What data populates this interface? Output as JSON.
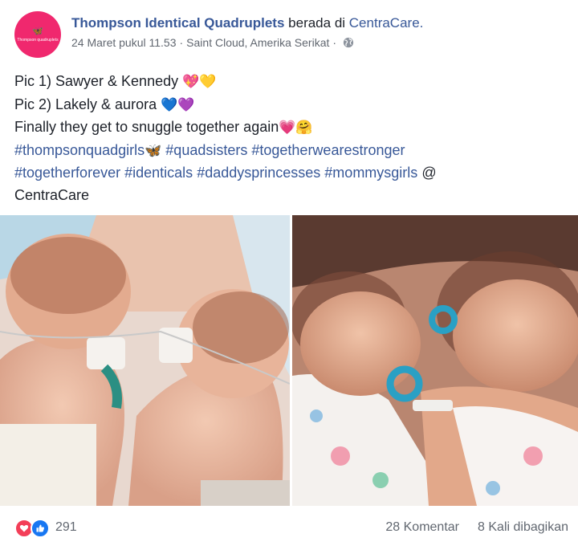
{
  "post": {
    "avatar_text": "Thompson quadruplets",
    "page_name": "Thompson Identical Quadruplets",
    "at_text": "berada di",
    "place": "CentraCare.",
    "timestamp": "24 Maret pukul 11.53",
    "separator": "·",
    "location": "Saint Cloud, Amerika Serikat",
    "privacy_icon": "globe-icon",
    "body": {
      "line1_text": "Pic 1) Sawyer & Kennedy",
      "line1_emoji": "💖💛",
      "line2_text": "Pic 2) Lakely & aurora",
      "line2_emoji": "💙💜",
      "line3_text": "Finally they get to snuggle together again",
      "line3_emoji": "💗🤗",
      "hashtags_line1": [
        "#thompsonquadgirls",
        "#quadsisters",
        "#togetherwearestronger"
      ],
      "hashtag_butterfly": "🦋",
      "hashtags_line2": [
        "#togetherforever",
        "#identicals",
        "#daddysprincesses",
        "#mommysgirls"
      ],
      "at_sign": "@",
      "mention": "CentraCare"
    }
  },
  "photos": [
    {
      "name": "photo-1"
    },
    {
      "name": "photo-2"
    }
  ],
  "footer": {
    "reaction_count": "291",
    "comments": "28 Komentar",
    "shares": "8 Kali dibagikan"
  },
  "colors": {
    "link": "#385898",
    "secondary": "#616770",
    "avatar_bg": "#f0286e",
    "love": "#f33e58",
    "like": "#1877f2"
  }
}
